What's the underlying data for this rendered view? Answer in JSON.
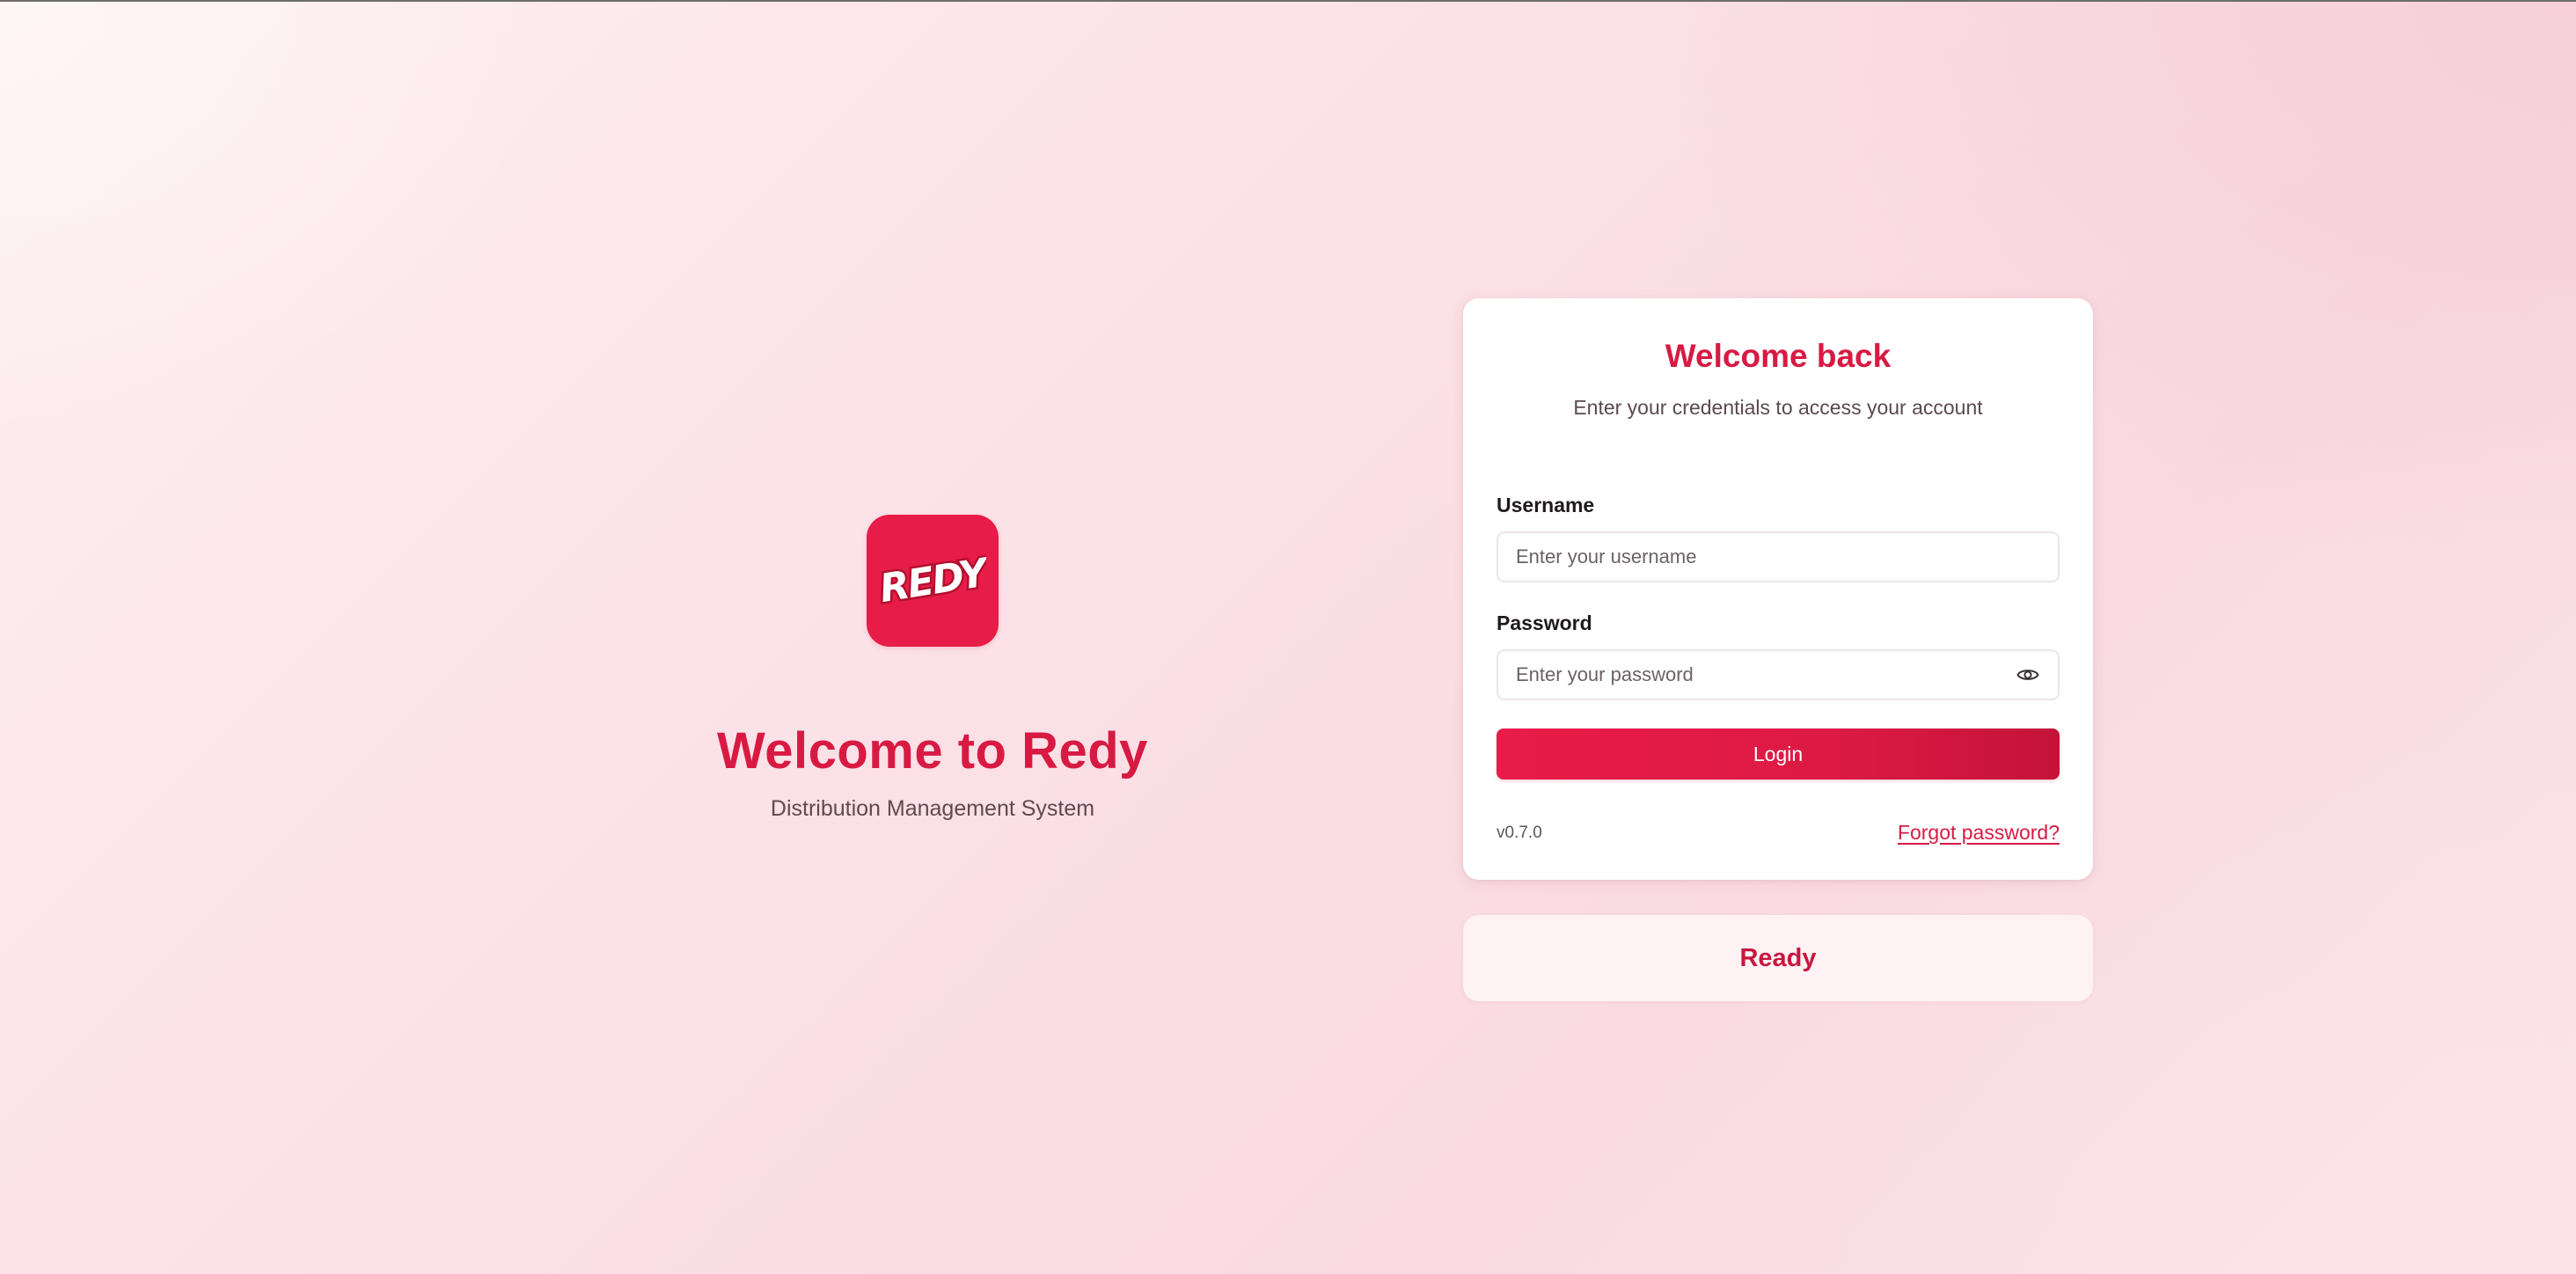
{
  "brand": {
    "logo_text": "REDY",
    "accent_color": "#e81c48"
  },
  "hero": {
    "title": "Welcome to Redy",
    "subtitle": "Distribution Management System"
  },
  "login": {
    "title": "Welcome back",
    "subtitle": "Enter your credentials to access your account",
    "username": {
      "label": "Username",
      "placeholder": "Enter your username",
      "value": ""
    },
    "password": {
      "label": "Password",
      "placeholder": "Enter your password",
      "value": "",
      "toggle_icon": "eye-icon"
    },
    "submit_label": "Login",
    "version": "v0.7.0",
    "forgot_label": "Forgot password?"
  },
  "status": {
    "text": "Ready"
  }
}
